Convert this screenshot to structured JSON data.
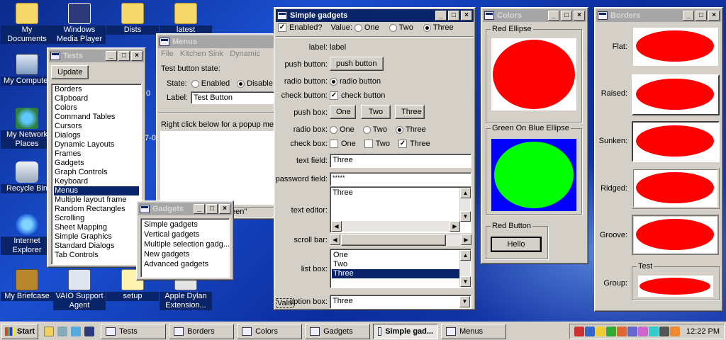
{
  "desktop": {
    "icons": [
      {
        "label": "My Documents"
      },
      {
        "label": "Windows Media Player"
      },
      {
        "label": "Dists"
      },
      {
        "label": "latest"
      },
      {
        "label": "My Computer"
      },
      {
        "label": "My Network Places"
      },
      {
        "label": "Recycle Bin"
      },
      {
        "label": "Internet Explorer"
      },
      {
        "label": "My Briefcase"
      },
      {
        "label": "VAIO Support Agent"
      },
      {
        "label": "setup"
      },
      {
        "label": "Apple Dylan Extension..."
      }
    ]
  },
  "tests_window": {
    "title": "Tests",
    "update_label": "Update",
    "items": [
      "Borders",
      "Clipboard",
      "Colors",
      "Command Tables",
      "Cursors",
      "Dialogs",
      "Dynamic Layouts",
      "Frames",
      "Gadgets",
      "Graph Controls",
      "Keyboard",
      "Menus",
      "Multiple layout frame",
      "Random Rectangles",
      "Scrolling",
      "Sheet Mapping",
      "Simple Graphics",
      "Standard Dialogs",
      "Tab Controls"
    ],
    "selected_item": "Menus"
  },
  "menus_window": {
    "title": "Menus",
    "menubar": [
      "File",
      "Kitchen Sink",
      "Dynamic"
    ],
    "state_heading": "Test button state:",
    "state_label": "State:",
    "state_options": [
      "Enabled",
      "Disable"
    ],
    "label_label": "Label:",
    "label_value": "Test Button",
    "popup_text": "Right click below for a popup men",
    "status_text": "een\""
  },
  "gadgets_window": {
    "title": "Gadgets",
    "items": [
      "Simple gadgets",
      "Vertical gadgets",
      "Multiple selection gadg...",
      "New gadgets",
      "Advanced gadgets"
    ]
  },
  "simple_gadgets": {
    "title": "Simple gadgets",
    "enabled_label": "Enabled?",
    "value_label": "Value:",
    "value_options": [
      "One",
      "Two",
      "Three"
    ],
    "value_selected": "Three",
    "rows": {
      "label_label": "label:",
      "label_value": "label",
      "push_button_label": "push button:",
      "push_button_text": "push button",
      "radio_button_label": "radio button:",
      "radio_button_text": "radio button",
      "check_button_label": "check button:",
      "check_button_text": "check button",
      "push_box_label": "push box:",
      "radio_box_label": "radio box:",
      "check_box_label": "check box:",
      "text_field_label": "text field:",
      "text_field_value": "Three",
      "password_field_label": "password field:",
      "password_field_value": "*****",
      "text_editor_label": "text editor:",
      "text_editor_value": "Three",
      "scroll_bar_label": "scroll bar:",
      "list_box_label": "list box:",
      "option_box_label": "option box:",
      "option_box_value": "Three"
    },
    "box_options": [
      "One",
      "Two",
      "Three"
    ],
    "list_selected": "Three",
    "edge_fragment": "Valu"
  },
  "colors_window": {
    "title": "Colors",
    "group1_label": "Red Ellipse",
    "group2_label": "Green On Blue Ellipse",
    "group3_label": "Red Button",
    "button_label": "Hello",
    "colors": {
      "red": "#ff0000",
      "green": "#00ff00",
      "blue": "#0000ff"
    }
  },
  "borders_window": {
    "title": "Borders",
    "rows": [
      "Flat:",
      "Raised:",
      "Sunken:",
      "Ridged:",
      "Groove:"
    ],
    "group_label": "Group:",
    "group_title": "Test"
  },
  "taskbar": {
    "start_label": "Start",
    "tasks": [
      "Tests",
      "Borders",
      "Colors",
      "Gadgets",
      "Simple gad...",
      "Menus"
    ],
    "active_task": "Simple gad...",
    "clock": "12:22 PM"
  },
  "fragments": {
    "tests_edge_a": "0",
    "tests_edge_b": "7-0"
  }
}
